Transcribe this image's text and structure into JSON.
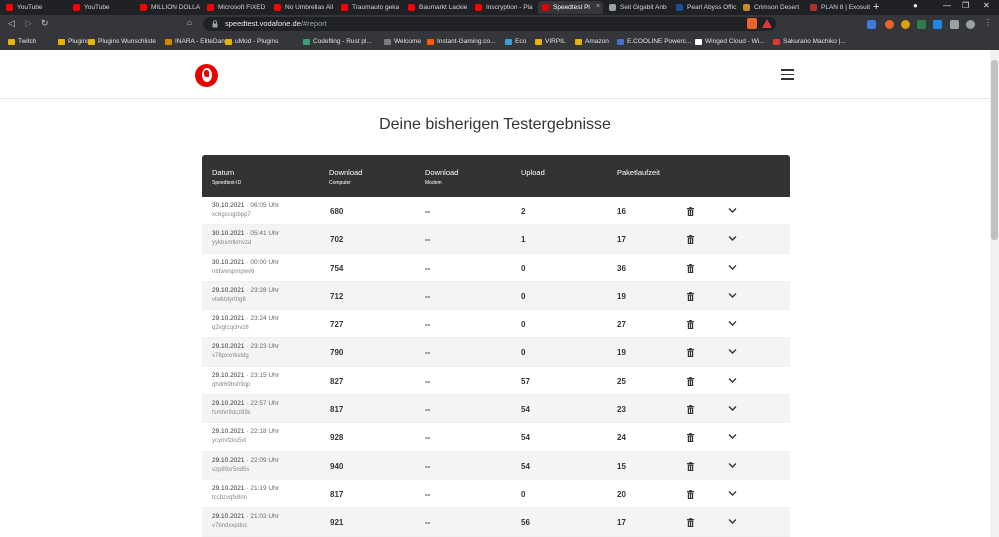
{
  "browser": {
    "tabs": [
      {
        "label": "YouTube",
        "color": "#ff0000"
      },
      {
        "label": "YouTube",
        "color": "#ff0000"
      },
      {
        "label": "MILLION DOLLA",
        "color": "#ff0000"
      },
      {
        "label": "Microsoft FIXED",
        "color": "#ff0000"
      },
      {
        "label": "No Umbrellas All",
        "color": "#ff0000"
      },
      {
        "label": "Traumauto geka",
        "color": "#ff0000"
      },
      {
        "label": "Baumarkt Lackie",
        "color": "#ff0000"
      },
      {
        "label": "Inscryption - Pla",
        "color": "#ff0000"
      },
      {
        "label": "Speedtest Pl",
        "color": "#e60000"
      },
      {
        "label": "Seit Gigabit Anb",
        "color": "#9aa0a6"
      },
      {
        "label": "Pearl Abyss Offic",
        "color": "#1a4fa0"
      },
      {
        "label": "Crimson Desert",
        "color": "#c98a2b"
      },
      {
        "label": "PLAN 8 | Exosuit",
        "color": "#b03030"
      }
    ],
    "new_tab_label": "+",
    "url_host": "speedtest.vodafone.de",
    "url_path": "/#report",
    "bookmarks": [
      {
        "label": "Twitch",
        "color": "#e8b400"
      },
      {
        "label": "Plugins",
        "color": "#e8b400"
      },
      {
        "label": "Plugins Wunschliste",
        "color": "#e8b400"
      },
      {
        "label": "INARA - EliteDang...",
        "color": "#d18a00"
      },
      {
        "label": "uMod - Plugins",
        "color": "#e8b400"
      },
      {
        "label": "Codefling - Rust pl...",
        "color": "#3aa07a"
      },
      {
        "label": "Welcome",
        "color": "#7b7b7b"
      },
      {
        "label": "Instant-Gaming.co...",
        "color": "#ff5a00"
      },
      {
        "label": "Eco",
        "color": "#3d9bd6"
      },
      {
        "label": "VIRPIL",
        "color": "#e8b400"
      },
      {
        "label": "Amazon",
        "color": "#e8b400"
      },
      {
        "label": "E.COOLINE Powerc...",
        "color": "#4a6fc7"
      },
      {
        "label": "Winged Cloud - Wi...",
        "color": "#ffffff"
      },
      {
        "label": "Sakurano Machiko |...",
        "color": "#d83a3a"
      }
    ]
  },
  "page": {
    "title": "Deine bisherigen Testergebnisse",
    "brand_color": "#e60000"
  },
  "table": {
    "headers": {
      "date": "Datum",
      "date_sub": "Speedtest-ID",
      "download_computer": "Download",
      "download_computer_sub": "Computer",
      "download_modem": "Download",
      "download_modem_sub": "Modem",
      "upload": "Upload",
      "ping": "Paketlaufzeit"
    },
    "rows": [
      {
        "date": "30.10.2021",
        "time": "· 06:05 Uhr",
        "id": "xc6gscqpbpp7",
        "download": "680",
        "modem": "--",
        "upload": "2",
        "ping": "16"
      },
      {
        "date": "30.10.2021",
        "time": "· 05:41 Uhr",
        "id": "yykbxmtkmvzd",
        "download": "702",
        "modem": "--",
        "upload": "1",
        "ping": "17"
      },
      {
        "date": "30.10.2021",
        "time": "· 00:00 Uhr",
        "id": "ntdwwspmpwv6",
        "download": "754",
        "modem": "--",
        "upload": "0",
        "ping": "36"
      },
      {
        "date": "29.10.2021",
        "time": "· 23:28 Uhr",
        "id": "vtwktdyrthg8",
        "download": "712",
        "modem": "--",
        "upload": "0",
        "ping": "19"
      },
      {
        "date": "29.10.2021",
        "time": "· 23:24 Uhr",
        "id": "q2vgtcqchvz8",
        "download": "727",
        "modem": "--",
        "upload": "0",
        "ping": "27"
      },
      {
        "date": "29.10.2021",
        "time": "· 23:23 Uhr",
        "id": "s78pxxnkstdg",
        "download": "790",
        "modem": "--",
        "upload": "0",
        "ping": "19"
      },
      {
        "date": "29.10.2021",
        "time": "· 23:15 Uhr",
        "id": "qhdr69bsh9qp",
        "download": "827",
        "modem": "--",
        "upload": "57",
        "ping": "25"
      },
      {
        "date": "29.10.2021",
        "time": "· 22:57 Uhr",
        "id": "fsmhn9dcz89x",
        "download": "817",
        "modem": "--",
        "upload": "54",
        "ping": "23"
      },
      {
        "date": "29.10.2021",
        "time": "· 22:18 Uhr",
        "id": "ycynvfzks5vt",
        "download": "928",
        "modem": "--",
        "upload": "54",
        "ping": "24"
      },
      {
        "date": "29.10.2021",
        "time": "· 22:09 Uhr",
        "id": "vzp89xr5nd5s",
        "download": "940",
        "modem": "--",
        "upload": "54",
        "ping": "15"
      },
      {
        "date": "29.10.2021",
        "time": "· 21:19 Uhr",
        "id": "tccbzvqfx8nn",
        "download": "817",
        "modem": "--",
        "upload": "0",
        "ping": "20"
      },
      {
        "date": "29.10.2021",
        "time": "· 21:02 Uhr",
        "id": "v7bndxxpdnc",
        "download": "921",
        "modem": "--",
        "upload": "56",
        "ping": "17"
      }
    ]
  }
}
